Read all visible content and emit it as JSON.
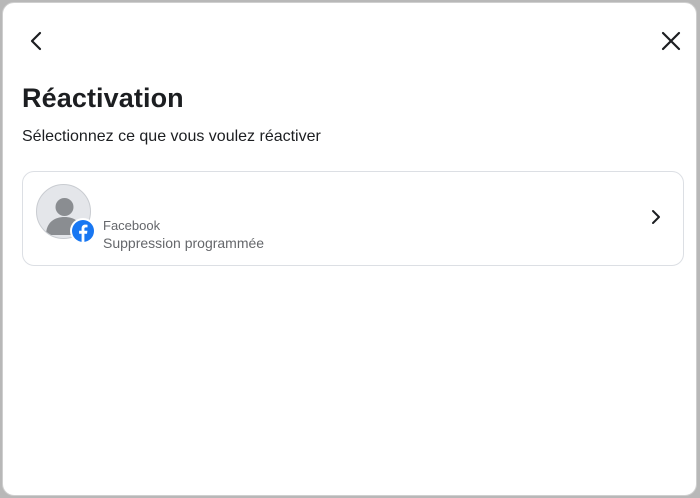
{
  "header": {
    "back_icon": "chevron-left-icon",
    "close_icon": "close-icon"
  },
  "title": "Réactivation",
  "subtitle": "Sélectionnez ce que vous voulez réactiver",
  "accounts": [
    {
      "name": "Facebook",
      "status": "Suppression programmée",
      "avatar_icon": "default-avatar-icon",
      "badge_icon": "facebook-icon",
      "badge_color": "#1877f2",
      "action_icon": "chevron-right-icon"
    }
  ],
  "colors": {
    "background_overlay": "#b8b8b8",
    "dialog_background": "#ffffff",
    "primary_text": "#1c1e21",
    "secondary_text": "#65676b",
    "facebook_blue": "#1877f2"
  }
}
